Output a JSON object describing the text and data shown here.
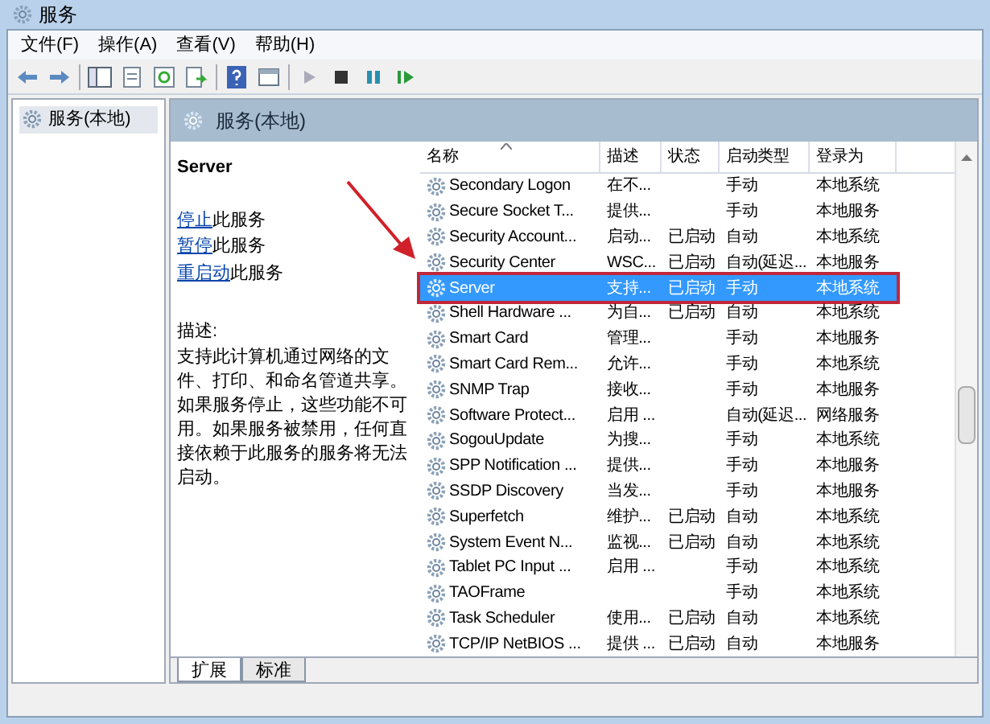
{
  "window": {
    "title": "服务"
  },
  "menu": [
    "文件(F)",
    "操作(A)",
    "查看(V)",
    "帮助(H)"
  ],
  "tree": {
    "items": [
      {
        "label": "服务(本地)",
        "selected": true
      }
    ]
  },
  "panel_header": "服务(本地)",
  "details": {
    "title": "Server",
    "actions": [
      {
        "link": "停止",
        "text": "此服务"
      },
      {
        "link": "暂停",
        "text": "此服务"
      },
      {
        "link": "重启动",
        "text": "此服务"
      }
    ],
    "description_label": "描述:",
    "description": "支持此计算机通过网络的文件、打印、和命名管道共享。如果服务停止，这些功能不可用。如果服务被禁用，任何直接依赖于此服务的服务将无法启动。"
  },
  "table": {
    "columns": [
      "名称",
      "描述",
      "状态",
      "启动类型",
      "登录为"
    ],
    "rows": [
      {
        "name": "Secondary Logon",
        "desc": "在不...",
        "status": "",
        "startup": "手动",
        "logon": "本地系统",
        "selected": false
      },
      {
        "name": "Secure Socket T...",
        "desc": "提供...",
        "status": "",
        "startup": "手动",
        "logon": "本地服务",
        "selected": false
      },
      {
        "name": "Security Account...",
        "desc": "启动...",
        "status": "已启动",
        "startup": "自动",
        "logon": "本地系统",
        "selected": false
      },
      {
        "name": "Security Center",
        "desc": "WSC...",
        "status": "已启动",
        "startup": "自动(延迟...",
        "logon": "本地服务",
        "selected": false
      },
      {
        "name": "Server",
        "desc": "支持...",
        "status": "已启动",
        "startup": "手动",
        "logon": "本地系统",
        "selected": true
      },
      {
        "name": "Shell Hardware ...",
        "desc": "为自...",
        "status": "已启动",
        "startup": "自动",
        "logon": "本地系统",
        "selected": false
      },
      {
        "name": "Smart Card",
        "desc": "管理...",
        "status": "",
        "startup": "手动",
        "logon": "本地服务",
        "selected": false
      },
      {
        "name": "Smart Card Rem...",
        "desc": "允许...",
        "status": "",
        "startup": "手动",
        "logon": "本地系统",
        "selected": false
      },
      {
        "name": "SNMP Trap",
        "desc": "接收...",
        "status": "",
        "startup": "手动",
        "logon": "本地服务",
        "selected": false
      },
      {
        "name": "Software Protect...",
        "desc": "启用 ...",
        "status": "",
        "startup": "自动(延迟...",
        "logon": "网络服务",
        "selected": false
      },
      {
        "name": "SogouUpdate",
        "desc": "为搜...",
        "status": "",
        "startup": "手动",
        "logon": "本地系统",
        "selected": false
      },
      {
        "name": "SPP Notification ...",
        "desc": "提供...",
        "status": "",
        "startup": "手动",
        "logon": "本地服务",
        "selected": false
      },
      {
        "name": "SSDP Discovery",
        "desc": "当发...",
        "status": "",
        "startup": "手动",
        "logon": "本地服务",
        "selected": false
      },
      {
        "name": "Superfetch",
        "desc": "维护...",
        "status": "已启动",
        "startup": "自动",
        "logon": "本地系统",
        "selected": false
      },
      {
        "name": "System Event N...",
        "desc": "监视...",
        "status": "已启动",
        "startup": "自动",
        "logon": "本地系统",
        "selected": false
      },
      {
        "name": "Tablet PC Input ...",
        "desc": "启用 ...",
        "status": "",
        "startup": "手动",
        "logon": "本地系统",
        "selected": false
      },
      {
        "name": "TAOFrame",
        "desc": "",
        "status": "",
        "startup": "手动",
        "logon": "本地系统",
        "selected": false
      },
      {
        "name": "Task Scheduler",
        "desc": "使用...",
        "status": "已启动",
        "startup": "自动",
        "logon": "本地系统",
        "selected": false
      },
      {
        "name": "TCP/IP NetBIOS ...",
        "desc": "提供 ...",
        "status": "已启动",
        "startup": "自动",
        "logon": "本地服务",
        "selected": false
      }
    ]
  },
  "bottom_tabs": [
    {
      "label": "扩展",
      "selected": true
    },
    {
      "label": "标准",
      "selected": false
    }
  ]
}
